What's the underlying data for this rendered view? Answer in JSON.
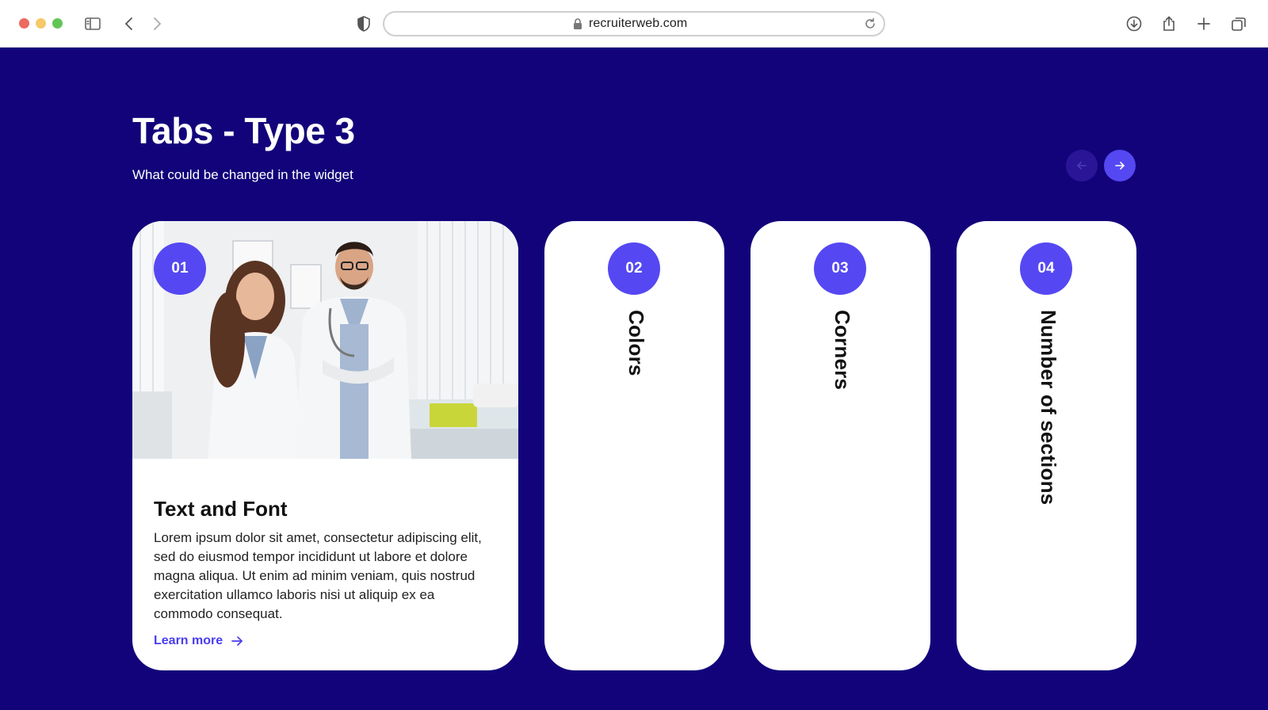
{
  "browser": {
    "url": "recruiterweb.com"
  },
  "section": {
    "title": "Tabs - Type 3",
    "subtitle": "What could be changed in the widget"
  },
  "tabs": [
    {
      "number": "01",
      "heading": "Text and Font",
      "body": "Lorem ipsum dolor sit amet, consectetur adipiscing elit, sed do eiusmod tempor incididunt ut labore et dolore magna aliqua. Ut enim ad minim veniam, quis nostrud exercitation ullamco laboris nisi ut aliquip ex ea commodo consequat.",
      "link_label": "Learn more"
    },
    {
      "number": "02",
      "label": "Colors"
    },
    {
      "number": "03",
      "label": "Corners"
    },
    {
      "number": "04",
      "label": "Number of sections"
    }
  ],
  "colors": {
    "background": "#12037a",
    "accent": "#5548f2",
    "card": "#ffffff"
  }
}
